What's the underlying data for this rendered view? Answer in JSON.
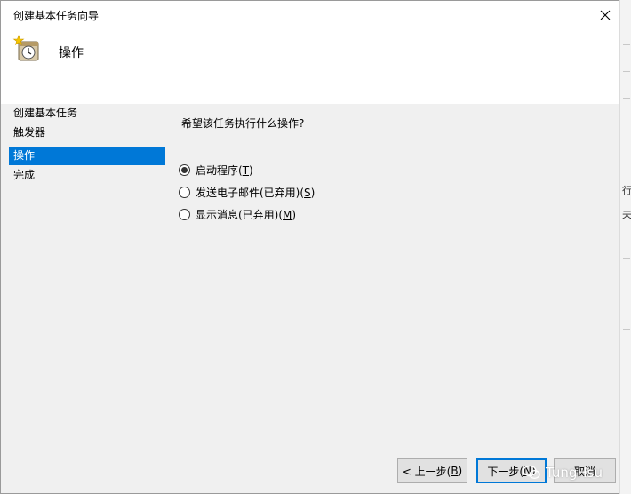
{
  "window": {
    "title": "创建基本任务向导",
    "close_label": "×"
  },
  "header": {
    "title": "操作",
    "icon": "task-clock-icon"
  },
  "nav": {
    "items": [
      {
        "label": "创建基本任务",
        "selected": false
      },
      {
        "label": "触发器",
        "selected": false
      },
      {
        "label": "操作",
        "selected": true
      },
      {
        "label": "完成",
        "selected": false
      }
    ]
  },
  "content": {
    "question": "希望该任务执行什么操作?",
    "options": [
      {
        "label": "启动程序(",
        "key": "T",
        "suffix": ")",
        "checked": true
      },
      {
        "label": "发送电子邮件(已弃用)(",
        "key": "S",
        "suffix": ")",
        "checked": false
      },
      {
        "label": "显示消息(已弃用)(",
        "key": "M",
        "suffix": ")",
        "checked": false
      }
    ]
  },
  "footer": {
    "back": {
      "label": "< 上一步(",
      "key": "B",
      "suffix": ")"
    },
    "next": {
      "label": "下一步(",
      "key": "N",
      "suffix": ")"
    },
    "cancel": {
      "label": "取消"
    }
  },
  "background_fragments": [
    "行",
    "夫"
  ],
  "watermark": "TungHsu",
  "colors": {
    "selected": "#0078d7",
    "dialog_bg": "#f0f0f0",
    "header_bg": "#ffffff"
  }
}
